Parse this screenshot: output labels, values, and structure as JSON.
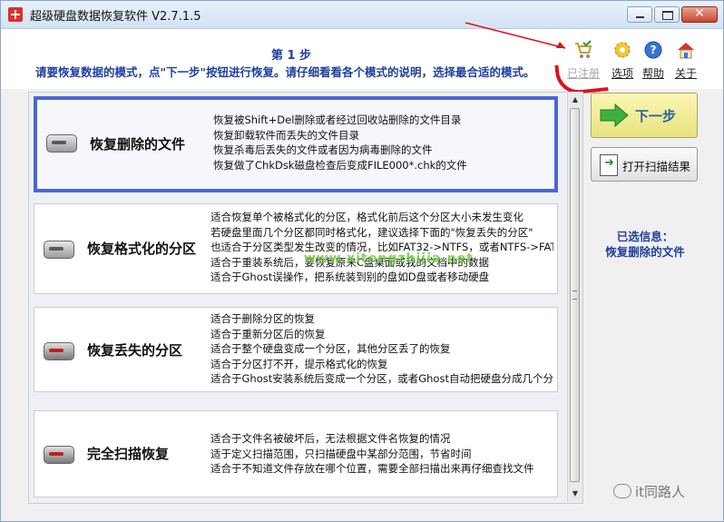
{
  "window": {
    "title": "超级硬盘数据恢复软件 V2.7.1.5",
    "close_symbol": "✕"
  },
  "header": {
    "step": "第 1 步",
    "instruction": "请要恢复数据的模式，点\"下一步\"按钮进行恢复。请仔细看看各个模式的说明，选择最合适的模式。"
  },
  "toolbar": [
    {
      "label": "已注册",
      "icon": "cart-icon",
      "enabled": false
    },
    {
      "label": "选项",
      "icon": "gear-icon",
      "enabled": true
    },
    {
      "label": "帮助",
      "icon": "help-icon",
      "enabled": true
    },
    {
      "label": "关于",
      "icon": "home-icon",
      "enabled": true
    }
  ],
  "options": [
    {
      "title": "恢复删除的文件",
      "selected": true,
      "lines": [
        "恢复被Shift+Del删除或者经过回收站删除的文件目录",
        "恢复卸载软件而丢失的文件目录",
        "恢复杀毒后丢失的文件或者因为病毒删除的文件",
        "恢复做了ChkDsk磁盘检查后变成FILE000*.chk的文件"
      ]
    },
    {
      "title": "恢复格式化的分区",
      "selected": false,
      "lines": [
        "适合恢复单个被格式化的分区，格式化前后这个分区大小未发生变化",
        "若硬盘里面几个分区都同时格式化，建议选择下面的\"恢复丢失的分区\"",
        "也适合于分区类型发生改变的情况，比如FAT32->NTFS，或者NTFS->FAT3",
        "适合于重装系统后，要恢复原来C盘桌面或我的文档中的数据",
        "适合于Ghost误操作，把系统装到别的盘如D盘或者移动硬盘"
      ]
    },
    {
      "title": "恢复丢失的分区",
      "selected": false,
      "lines": [
        "适合于删除分区的恢复",
        "适合于重新分区后的恢复",
        "适合于整个硬盘变成一个分区，其他分区丢了的恢复",
        "适合于分区打不开，提示格式化的恢复",
        "适合于Ghost安装系统后变成一个分区，或者Ghost自动把硬盘分成几个分"
      ]
    },
    {
      "title": "完全扫描恢复",
      "selected": false,
      "lines": [
        "适合于文件名被破坏后，无法根据文件名恢复的情况",
        "适于定义扫描范围，只扫描硬盘中某部分范围，节省时间",
        "适合于不知道文件存放在哪个位置，需要全部扫描出来再仔细查找文件"
      ]
    }
  ],
  "watermark_mid": "www.xitongzhijia.net",
  "buttons": {
    "next": "下一步",
    "open_scan": "打开扫描结果"
  },
  "selected_info": {
    "label": "已选信息：",
    "value": "恢复删除的文件"
  },
  "footer_watermark": "it同路人",
  "colors": {
    "accent": "#1f3fa0",
    "selection_border": "#4a67d2",
    "next_button": "#fbf7b4",
    "annotation_red": "#e0101a"
  }
}
